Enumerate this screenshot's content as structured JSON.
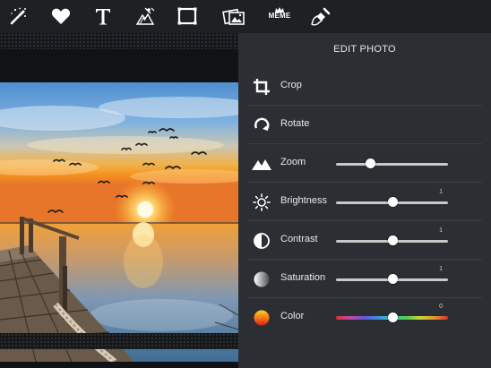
{
  "toolbar": {
    "tools": [
      {
        "name": "magic-wand-tool"
      },
      {
        "name": "favorite-tool"
      },
      {
        "name": "text-tool"
      },
      {
        "name": "frame-stamp-tool"
      },
      {
        "name": "border-tool"
      },
      {
        "name": "sticker-tool"
      },
      {
        "name": "meme-tool",
        "label": "MEME"
      },
      {
        "name": "brush-tool"
      }
    ]
  },
  "panel": {
    "title": "EDIT PHOTO",
    "items": [
      {
        "label": "Crop",
        "icon": "crop-icon"
      },
      {
        "label": "Rotate",
        "icon": "rotate-icon"
      },
      {
        "label": "Zoom",
        "icon": "mountains-icon",
        "value": 0.3
      },
      {
        "label": "Brightness",
        "icon": "sun-icon",
        "value": 0.5,
        "value_label": "1"
      },
      {
        "label": "Contrast",
        "icon": "contrast-icon",
        "value": 0.5,
        "value_label": "1"
      },
      {
        "label": "Saturation",
        "icon": "saturation-icon",
        "value": 0.5,
        "value_label": "1"
      },
      {
        "label": "Color",
        "icon": "color-icon",
        "value": 0.5,
        "value_label": "0"
      }
    ]
  },
  "colors": {
    "toolbar_bg": "#1e2024",
    "panel_bg": "#2b2e33",
    "accent_sun": "#f7b41e"
  }
}
